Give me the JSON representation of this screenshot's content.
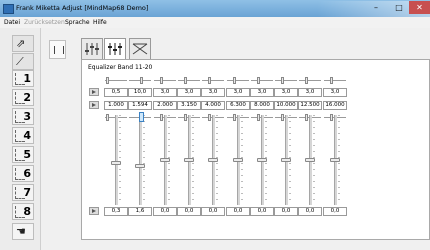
{
  "window": {
    "title": "Frank Miketta Adjust [MindMap68 Demo]",
    "minimize_glyph": "–",
    "maximize_glyph": "□",
    "close_glyph": "✕"
  },
  "menu": [
    {
      "label": "Datei",
      "enabled": true
    },
    {
      "label": "Zurücksetzen",
      "enabled": false
    },
    {
      "label": "Sprache",
      "enabled": true
    },
    {
      "label": "Hilfe",
      "enabled": true
    }
  ],
  "sidebar": {
    "top_buttons": [
      "preset-arrow-icon",
      "preset-slash-icon"
    ],
    "presets": [
      "1",
      "2",
      "3",
      "4",
      "5",
      "6",
      "7",
      "8"
    ],
    "bottom_button": "preset-hand-icon"
  },
  "tabs": [
    {
      "icon": "equalizer-sliders-icon",
      "active": false
    },
    {
      "icon": "equalizer-sliders-icon",
      "active": true
    },
    {
      "icon": "crossover-curve-icon",
      "active": false
    }
  ],
  "section_title": "Equalizer Band 11-20",
  "bands": {
    "q_values": [
      "0,5",
      "10,0",
      "3,0",
      "3,0",
      "3,0",
      "3,0",
      "3,0",
      "3,0",
      "3,0",
      "3,0"
    ],
    "frequencies": [
      "1.000",
      "1.594",
      "2.000",
      "3.150",
      "4.000",
      "6.300",
      "8.000",
      "10.000",
      "12.500",
      "16.000"
    ],
    "gains": [
      "0,3",
      "1,6",
      "0,0",
      "0,0",
      "0,0",
      "0,0",
      "0,0",
      "0,0",
      "0,0",
      "0,0"
    ],
    "q_slider_level": [
      0.05,
      0.55,
      0.3,
      0.3,
      0.3,
      0.3,
      0.3,
      0.3,
      0.3,
      0.3
    ],
    "freq_slider_level": [
      0.05,
      0.55,
      0.3,
      0.3,
      0.3,
      0.3,
      0.3,
      0.3,
      0.3,
      0.3
    ],
    "gain_slider_level": [
      0.53,
      0.57,
      0.5,
      0.5,
      0.5,
      0.5,
      0.5,
      0.5,
      0.5,
      0.5
    ]
  }
}
